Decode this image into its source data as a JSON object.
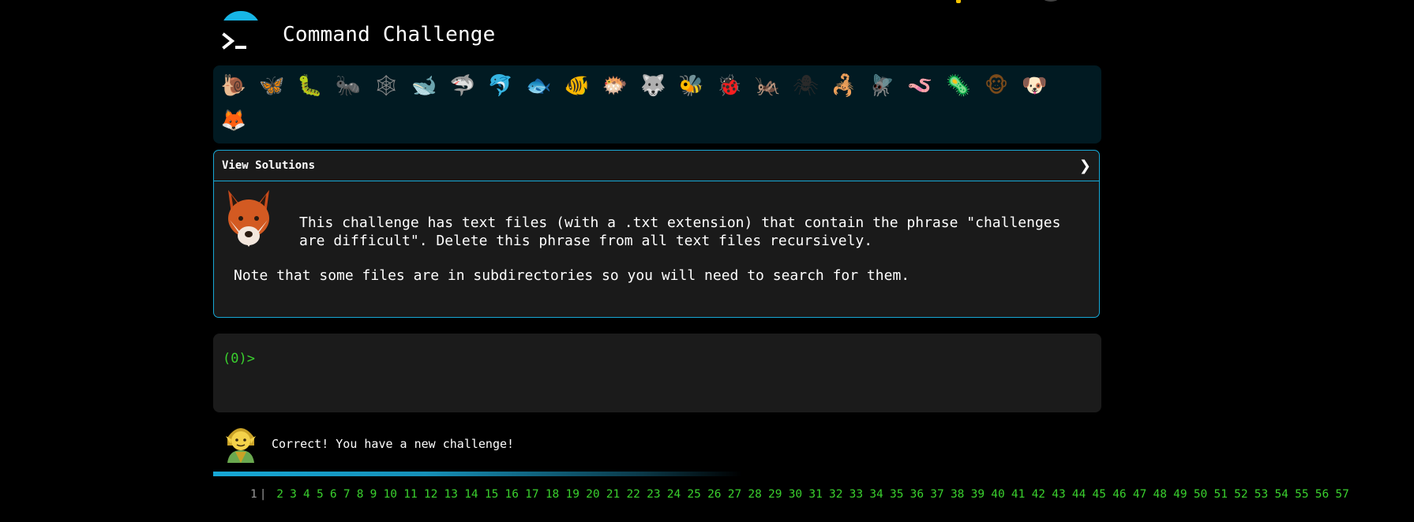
{
  "app": {
    "title": "Command Challenge"
  },
  "animals": [
    {
      "name": "snail",
      "glyph": "🐌",
      "color": "#b07a3a"
    },
    {
      "name": "butterfly",
      "glyph": "🦋",
      "color": "#e07a2a"
    },
    {
      "name": "bug",
      "glyph": "🐛",
      "color": "#4fae2a"
    },
    {
      "name": "ant",
      "glyph": "🐜",
      "color": "#7a2a0a"
    },
    {
      "name": "spider-web",
      "glyph": "🕸",
      "color": "#8a8a8a"
    },
    {
      "name": "whale",
      "glyph": "🐋",
      "color": "#3a8ac0"
    },
    {
      "name": "shark",
      "glyph": "🦈",
      "color": "#3a8ac0"
    },
    {
      "name": "dolphin",
      "glyph": "🐬",
      "color": "#9ab0c0"
    },
    {
      "name": "fish",
      "glyph": "🐟",
      "color": "#3aa0e0"
    },
    {
      "name": "tropical-fish",
      "glyph": "🐠",
      "color": "#f0c020"
    },
    {
      "name": "blowfish",
      "glyph": "🐡",
      "color": "#b07a3a"
    },
    {
      "name": "wolf",
      "glyph": "🐺",
      "color": "#8a8a8a"
    },
    {
      "name": "bee",
      "glyph": "🐝",
      "color": "#e0c020"
    },
    {
      "name": "ladybug",
      "glyph": "🐞",
      "color": "#d02a2a"
    },
    {
      "name": "cricket",
      "glyph": "🦗",
      "color": "#4fae2a"
    },
    {
      "name": "spider",
      "glyph": "🕷",
      "color": "#2a2a2a"
    },
    {
      "name": "scorpion",
      "glyph": "🦂",
      "color": "#c03a1a"
    },
    {
      "name": "fly",
      "glyph": "🪰",
      "color": "#8a8a8a"
    },
    {
      "name": "worm",
      "glyph": "🪱",
      "color": "#e07a9a"
    },
    {
      "name": "microbe",
      "glyph": "🦠",
      "color": "#3a8ac0"
    },
    {
      "name": "monkey",
      "glyph": "🐵",
      "color": "#7a4a1a"
    },
    {
      "name": "dog",
      "glyph": "🐶",
      "color": "#d08a2a"
    },
    {
      "name": "fox",
      "glyph": "🦊",
      "color": "#e06a2a"
    }
  ],
  "solutions": {
    "label": "View Solutions",
    "challenge_text": "This challenge has text files (with a .txt extension) that contain the phrase \"challenges are difficult\". Delete this phrase from all text files recursively.",
    "note": "Note that some files are in subdirectories so you will need to search for them."
  },
  "terminal": {
    "prompt": "(0)>"
  },
  "feedback": {
    "message": "Correct! You have a new challenge!"
  },
  "pager": {
    "current": "1",
    "pages": [
      "1",
      "2",
      "3",
      "4",
      "5",
      "6",
      "7",
      "8",
      "9",
      "10",
      "11",
      "12",
      "13",
      "14",
      "15",
      "16",
      "17",
      "18",
      "19",
      "20",
      "21",
      "22",
      "23",
      "24",
      "25",
      "26",
      "27",
      "28",
      "29",
      "30",
      "31",
      "32",
      "33",
      "34",
      "35",
      "36",
      "37",
      "38",
      "39",
      "40",
      "41",
      "42",
      "43",
      "44",
      "45",
      "46",
      "47",
      "48",
      "49",
      "50",
      "51",
      "52",
      "53",
      "54",
      "55",
      "56",
      "57"
    ]
  },
  "colors": {
    "accent": "#17a8d6",
    "prompt_green": "#3ad02e",
    "panel_bg": "#1a1a1a",
    "animal_bar_bg": "#011a22"
  }
}
